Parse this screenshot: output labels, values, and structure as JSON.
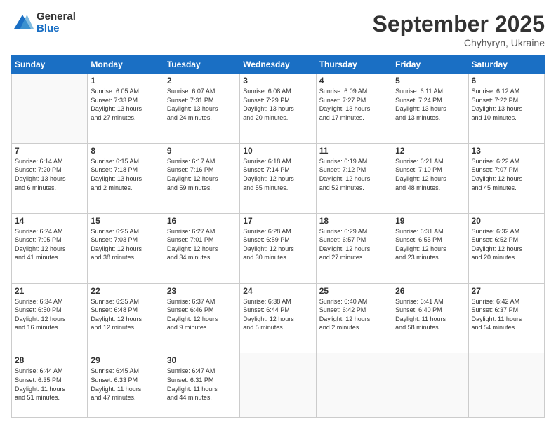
{
  "logo": {
    "general": "General",
    "blue": "Blue"
  },
  "title": "September 2025",
  "location": "Chyhyryn, Ukraine",
  "days_header": [
    "Sunday",
    "Monday",
    "Tuesday",
    "Wednesday",
    "Thursday",
    "Friday",
    "Saturday"
  ],
  "weeks": [
    [
      {
        "num": "",
        "info": ""
      },
      {
        "num": "1",
        "info": "Sunrise: 6:05 AM\nSunset: 7:33 PM\nDaylight: 13 hours\nand 27 minutes."
      },
      {
        "num": "2",
        "info": "Sunrise: 6:07 AM\nSunset: 7:31 PM\nDaylight: 13 hours\nand 24 minutes."
      },
      {
        "num": "3",
        "info": "Sunrise: 6:08 AM\nSunset: 7:29 PM\nDaylight: 13 hours\nand 20 minutes."
      },
      {
        "num": "4",
        "info": "Sunrise: 6:09 AM\nSunset: 7:27 PM\nDaylight: 13 hours\nand 17 minutes."
      },
      {
        "num": "5",
        "info": "Sunrise: 6:11 AM\nSunset: 7:24 PM\nDaylight: 13 hours\nand 13 minutes."
      },
      {
        "num": "6",
        "info": "Sunrise: 6:12 AM\nSunset: 7:22 PM\nDaylight: 13 hours\nand 10 minutes."
      }
    ],
    [
      {
        "num": "7",
        "info": "Sunrise: 6:14 AM\nSunset: 7:20 PM\nDaylight: 13 hours\nand 6 minutes."
      },
      {
        "num": "8",
        "info": "Sunrise: 6:15 AM\nSunset: 7:18 PM\nDaylight: 13 hours\nand 2 minutes."
      },
      {
        "num": "9",
        "info": "Sunrise: 6:17 AM\nSunset: 7:16 PM\nDaylight: 12 hours\nand 59 minutes."
      },
      {
        "num": "10",
        "info": "Sunrise: 6:18 AM\nSunset: 7:14 PM\nDaylight: 12 hours\nand 55 minutes."
      },
      {
        "num": "11",
        "info": "Sunrise: 6:19 AM\nSunset: 7:12 PM\nDaylight: 12 hours\nand 52 minutes."
      },
      {
        "num": "12",
        "info": "Sunrise: 6:21 AM\nSunset: 7:10 PM\nDaylight: 12 hours\nand 48 minutes."
      },
      {
        "num": "13",
        "info": "Sunrise: 6:22 AM\nSunset: 7:07 PM\nDaylight: 12 hours\nand 45 minutes."
      }
    ],
    [
      {
        "num": "14",
        "info": "Sunrise: 6:24 AM\nSunset: 7:05 PM\nDaylight: 12 hours\nand 41 minutes."
      },
      {
        "num": "15",
        "info": "Sunrise: 6:25 AM\nSunset: 7:03 PM\nDaylight: 12 hours\nand 38 minutes."
      },
      {
        "num": "16",
        "info": "Sunrise: 6:27 AM\nSunset: 7:01 PM\nDaylight: 12 hours\nand 34 minutes."
      },
      {
        "num": "17",
        "info": "Sunrise: 6:28 AM\nSunset: 6:59 PM\nDaylight: 12 hours\nand 30 minutes."
      },
      {
        "num": "18",
        "info": "Sunrise: 6:29 AM\nSunset: 6:57 PM\nDaylight: 12 hours\nand 27 minutes."
      },
      {
        "num": "19",
        "info": "Sunrise: 6:31 AM\nSunset: 6:55 PM\nDaylight: 12 hours\nand 23 minutes."
      },
      {
        "num": "20",
        "info": "Sunrise: 6:32 AM\nSunset: 6:52 PM\nDaylight: 12 hours\nand 20 minutes."
      }
    ],
    [
      {
        "num": "21",
        "info": "Sunrise: 6:34 AM\nSunset: 6:50 PM\nDaylight: 12 hours\nand 16 minutes."
      },
      {
        "num": "22",
        "info": "Sunrise: 6:35 AM\nSunset: 6:48 PM\nDaylight: 12 hours\nand 12 minutes."
      },
      {
        "num": "23",
        "info": "Sunrise: 6:37 AM\nSunset: 6:46 PM\nDaylight: 12 hours\nand 9 minutes."
      },
      {
        "num": "24",
        "info": "Sunrise: 6:38 AM\nSunset: 6:44 PM\nDaylight: 12 hours\nand 5 minutes."
      },
      {
        "num": "25",
        "info": "Sunrise: 6:40 AM\nSunset: 6:42 PM\nDaylight: 12 hours\nand 2 minutes."
      },
      {
        "num": "26",
        "info": "Sunrise: 6:41 AM\nSunset: 6:40 PM\nDaylight: 11 hours\nand 58 minutes."
      },
      {
        "num": "27",
        "info": "Sunrise: 6:42 AM\nSunset: 6:37 PM\nDaylight: 11 hours\nand 54 minutes."
      }
    ],
    [
      {
        "num": "28",
        "info": "Sunrise: 6:44 AM\nSunset: 6:35 PM\nDaylight: 11 hours\nand 51 minutes."
      },
      {
        "num": "29",
        "info": "Sunrise: 6:45 AM\nSunset: 6:33 PM\nDaylight: 11 hours\nand 47 minutes."
      },
      {
        "num": "30",
        "info": "Sunrise: 6:47 AM\nSunset: 6:31 PM\nDaylight: 11 hours\nand 44 minutes."
      },
      {
        "num": "",
        "info": ""
      },
      {
        "num": "",
        "info": ""
      },
      {
        "num": "",
        "info": ""
      },
      {
        "num": "",
        "info": ""
      }
    ]
  ]
}
